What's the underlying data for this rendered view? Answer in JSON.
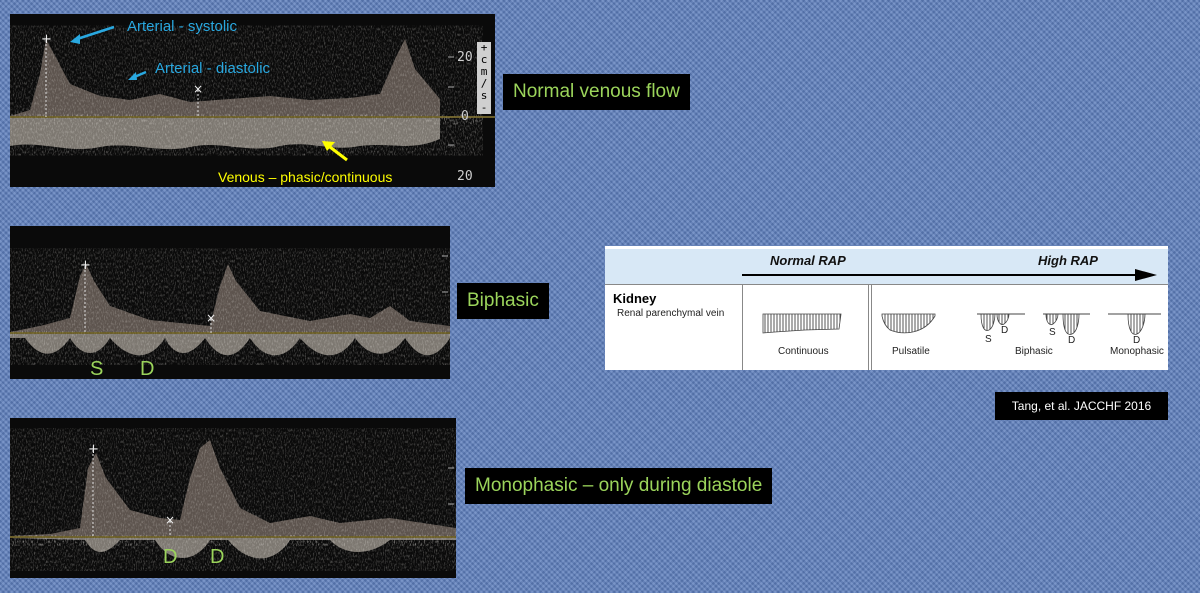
{
  "panels": [
    {
      "label": "Normal venous flow",
      "annotations": {
        "arterial_systolic": "Arterial - systolic",
        "arterial_diastolic": "Arterial - diastolic",
        "venous": "Venous – phasic/continuous"
      },
      "scale": {
        "top": "20",
        "zero": "0",
        "bottom": "20",
        "unit_chars": [
          "+",
          "c",
          "m",
          "/",
          "s",
          "-"
        ]
      }
    },
    {
      "label": "Biphasic",
      "markers": [
        "S",
        "D"
      ]
    },
    {
      "label": "Monophasic – only during diastole",
      "markers": [
        "D",
        "D"
      ]
    }
  ],
  "reference_figure": {
    "header_left": "Normal RAP",
    "header_right": "High RAP",
    "row_title": "Kidney",
    "row_subtitle": "Renal parenchymal vein",
    "patterns": {
      "continuous": "Continuous",
      "pulsatile": "Pulsatile",
      "biphasic": "Biphasic",
      "monophasic": "Monophasic"
    },
    "wave_letters": {
      "s1": "S",
      "d1": "D",
      "s2": "S",
      "d2": "D",
      "d3": "D"
    }
  },
  "citation": "Tang, et al. JACCHF 2016",
  "colors": {
    "background": "#5e7fbd",
    "label_text": "#9bd45b",
    "arterial_annotation": "#29a8e0",
    "venous_annotation": "#ffff00",
    "baseline": "#8a7a35"
  }
}
